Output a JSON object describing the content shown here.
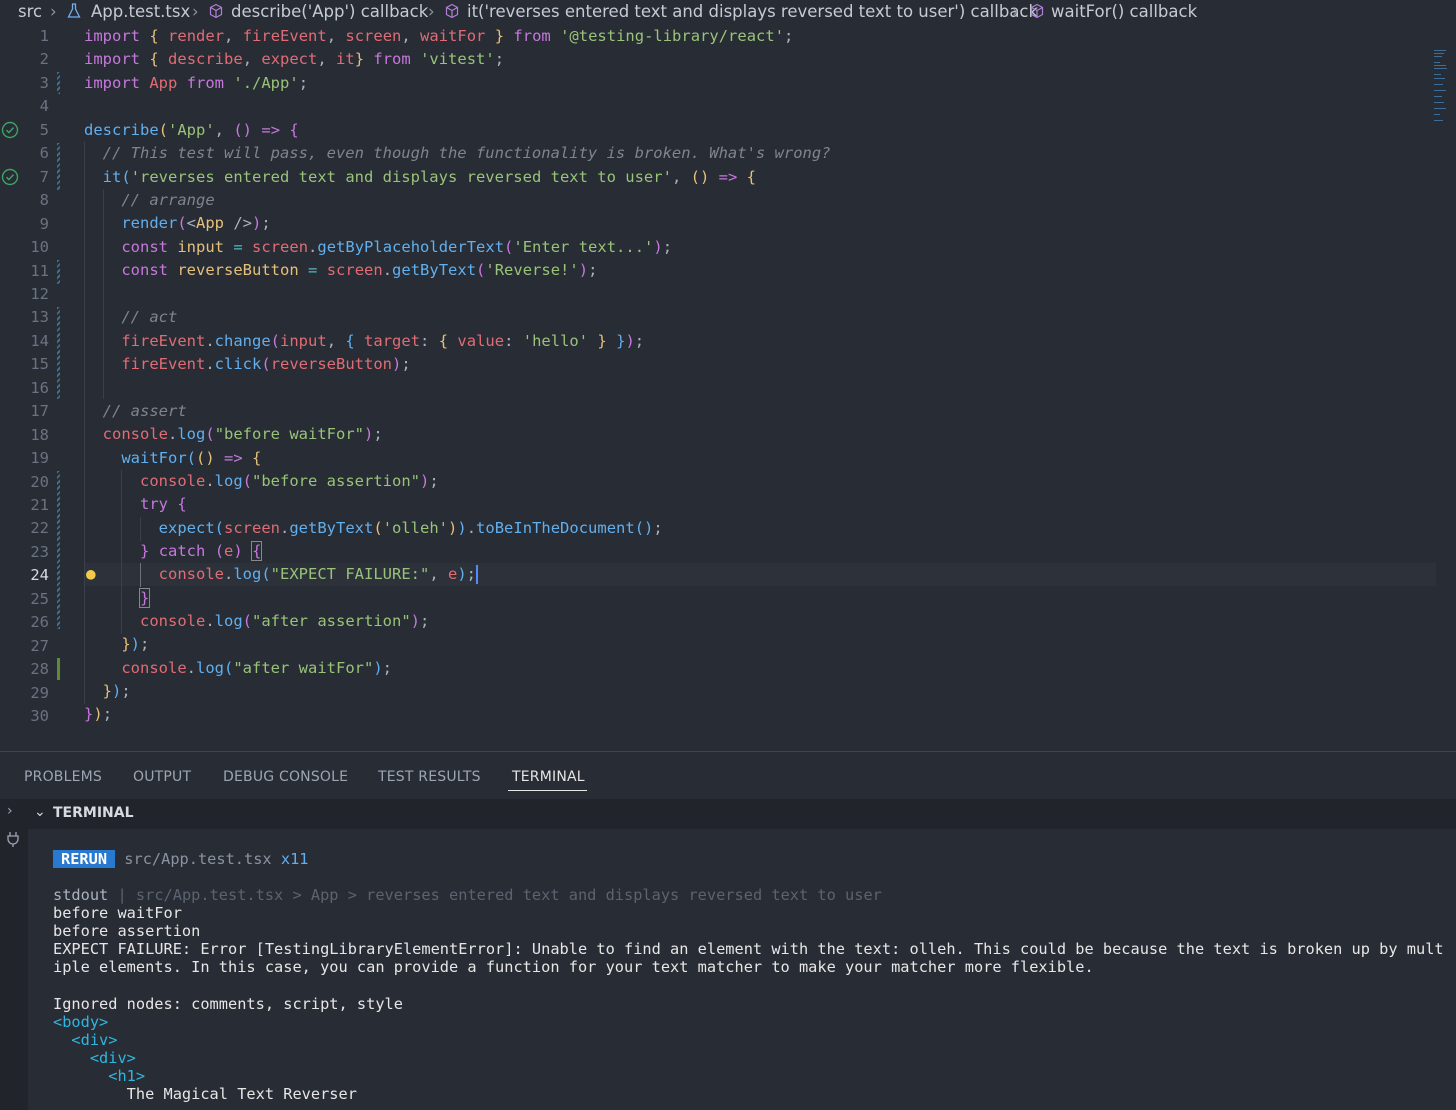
{
  "breadcrumb": {
    "items": [
      "src",
      "App.test.tsx",
      "describe('App') callback",
      "it('reverses entered text and displays reversed text to user') callback",
      "waitFor() callback"
    ],
    "icons": [
      "flask-icon",
      "cube-icon",
      "cube-icon",
      "cube-icon"
    ]
  },
  "editor": {
    "line_numbers": [
      "1",
      "2",
      "3",
      "4",
      "5",
      "6",
      "7",
      "8",
      "9",
      "10",
      "11",
      "12",
      "13",
      "14",
      "15",
      "16",
      "17",
      "18",
      "19",
      "20",
      "21",
      "22",
      "23",
      "24",
      "25",
      "26",
      "27",
      "28",
      "29",
      "30"
    ],
    "active_line": "24",
    "colors": {
      "background": "#282c34",
      "keyword": "#c678dd",
      "function": "#61afef",
      "string": "#98c379",
      "variable": "#e06c75",
      "comment": "#7f848e"
    }
  },
  "panel": {
    "tabs": [
      "PROBLEMS",
      "OUTPUT",
      "DEBUG CONSOLE",
      "TEST RESULTS",
      "TERMINAL"
    ],
    "active_tab": "TERMINAL",
    "section_title": "TERMINAL",
    "terminal": {
      "rerun_badge": "RERUN",
      "rerun_file": "src/App.test.tsx",
      "rerun_count": "x11",
      "stdout_label": "stdout",
      "stdout_path": "| src/App.test.tsx > App > reverses entered text and displays reversed text to user",
      "lines": [
        "before waitFor",
        "before assertion",
        "EXPECT FAILURE: Error [TestingLibraryElementError]: Unable to find an element with the text: olleh. This could be because the text is broken up by mult",
        "iple elements. In this case, you can provide a function for your text matcher to make your matcher more flexible.",
        "",
        "Ignored nodes: comments, script, style"
      ],
      "tags": [
        "<body>",
        "  <div>",
        "    <div>",
        "      <h1>"
      ],
      "last_line": "        The Magical Text Reverser"
    }
  }
}
